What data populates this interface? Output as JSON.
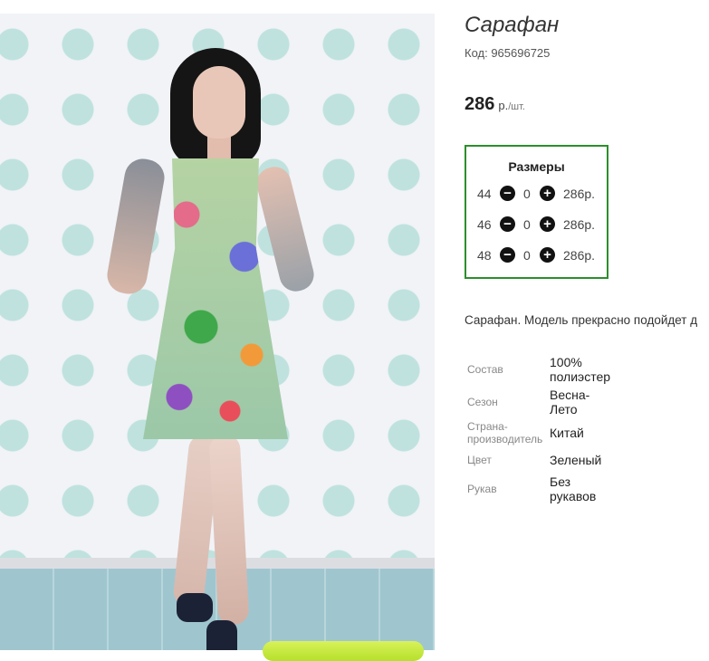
{
  "product": {
    "title": "Сарафан",
    "code_label": "Код: 965696725",
    "price": {
      "amount": "286",
      "currency": "р.",
      "unit": "/шт."
    }
  },
  "sizes": {
    "title": "Размеры",
    "rows": [
      {
        "size": "44",
        "qty": "0",
        "price": "286р."
      },
      {
        "size": "46",
        "qty": "0",
        "price": "286р."
      },
      {
        "size": "48",
        "qty": "0",
        "price": "286р."
      }
    ],
    "minus_icon": "minus-circle-icon",
    "plus_icon": "plus-circle-icon",
    "border_color": "#2b8f2b"
  },
  "description": "Сарафан. Модель прекрасно подойдет д",
  "attributes": [
    {
      "label": "Состав",
      "value": "100% полиэстер"
    },
    {
      "label": "Сезон",
      "value": "Весна-Лето"
    },
    {
      "label": "Страна-производитель",
      "value": "Китай"
    },
    {
      "label": "Цвет",
      "value": "Зеленый"
    },
    {
      "label": "Рукав",
      "value": "Без рукавов"
    }
  ],
  "colors": {
    "accent_button": "#c4e83a"
  }
}
